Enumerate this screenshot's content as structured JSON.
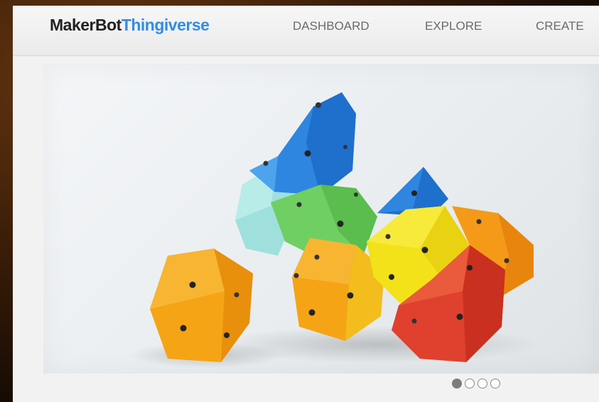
{
  "logo": {
    "part1": "MakerBot",
    "part2": "Thingiverse"
  },
  "nav": [
    "DASHBOARD",
    "EXPLORE",
    "CREATE"
  ],
  "hero": {
    "image": "colorful 3D printed polyhedra with magnets"
  },
  "carousel": {
    "count": 4,
    "active": 1
  },
  "colors": {
    "brand_blue": "#2f8ee5",
    "nav_text": "#6a6a6a"
  }
}
